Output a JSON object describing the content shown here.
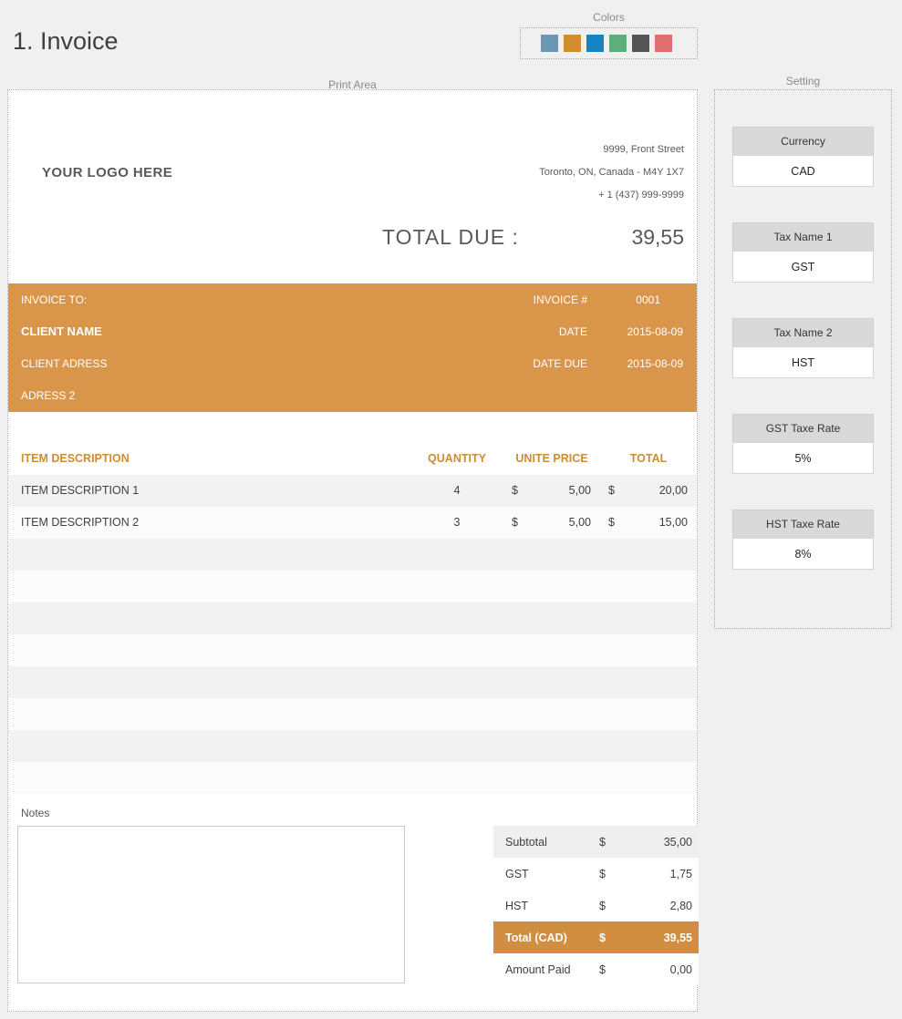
{
  "page": {
    "title": "1. Invoice"
  },
  "colors_panel": {
    "label": "Colors",
    "swatches": [
      {
        "name": "steel-blue",
        "hex": "#6b96b4"
      },
      {
        "name": "orange",
        "hex": "#d28c31"
      },
      {
        "name": "blue",
        "hex": "#1583c2"
      },
      {
        "name": "green",
        "hex": "#5ead7b"
      },
      {
        "name": "dark-gray",
        "hex": "#545454"
      },
      {
        "name": "red",
        "hex": "#df6f6f"
      }
    ]
  },
  "print_area": {
    "label": "Print Area"
  },
  "company": {
    "logo_text": "YOUR LOGO HERE",
    "address_line1": "9999, Front Street",
    "address_line2": "Toronto, ON, Canada  - M4Y 1X7",
    "address_line3": "+ 1 (437) 999-9999"
  },
  "total_due": {
    "label": "TOTAL DUE :",
    "value": "39,55"
  },
  "bill_to": {
    "label": "INVOICE TO:",
    "client_name": "CLIENT NAME",
    "address1": "CLIENT ADRESS",
    "address2": "ADRESS 2",
    "meta": [
      {
        "label": "INVOICE #",
        "value": "0001"
      },
      {
        "label": "DATE",
        "value": "2015-08-09"
      },
      {
        "label": "DATE DUE",
        "value": "2015-08-09"
      }
    ]
  },
  "items": {
    "headers": {
      "description": "ITEM DESCRIPTION",
      "quantity": "QUANTITY",
      "unit_price": "UNITE PRICE",
      "total": "TOTAL"
    },
    "currency_symbol": "$",
    "rows": [
      {
        "description": "ITEM DESCRIPTION 1",
        "quantity": "4",
        "unit_price": "5,00",
        "total": "20,00"
      },
      {
        "description": "ITEM DESCRIPTION 2",
        "quantity": "3",
        "unit_price": "5,00",
        "total": "15,00"
      }
    ],
    "empty_row_count": 8
  },
  "notes": {
    "label": "Notes",
    "value": ""
  },
  "totals": {
    "rows": [
      {
        "label": "Subtotal",
        "symbol": "$",
        "value": "35,00"
      },
      {
        "label": "GST",
        "symbol": "$",
        "value": "1,75"
      },
      {
        "label": "HST",
        "symbol": "$",
        "value": "2,80"
      },
      {
        "label": "Total (CAD)",
        "symbol": "$",
        "value": "39,55"
      },
      {
        "label": "Amount Paid",
        "symbol": "$",
        "value": "0,00"
      }
    ]
  },
  "settings": {
    "label": "Setting",
    "fields": [
      {
        "label": "Currency",
        "value": "CAD"
      },
      {
        "label": "Tax Name 1",
        "value": "GST"
      },
      {
        "label": "Tax Name 2",
        "value": "HST"
      },
      {
        "label": "GST Taxe Rate",
        "value": "5%"
      },
      {
        "label": "HST Taxe Rate",
        "value": "8%"
      }
    ]
  },
  "theme": {
    "page_background": "#f0f0f0",
    "accent_orange": "#d9964b",
    "totals_orange": "#d18e40",
    "header_text_orange": "#cf8b33",
    "stripe_gray": "#f2f2f2",
    "label_gray": "#8a8a8a",
    "text_dark": "#3f3f3f"
  }
}
